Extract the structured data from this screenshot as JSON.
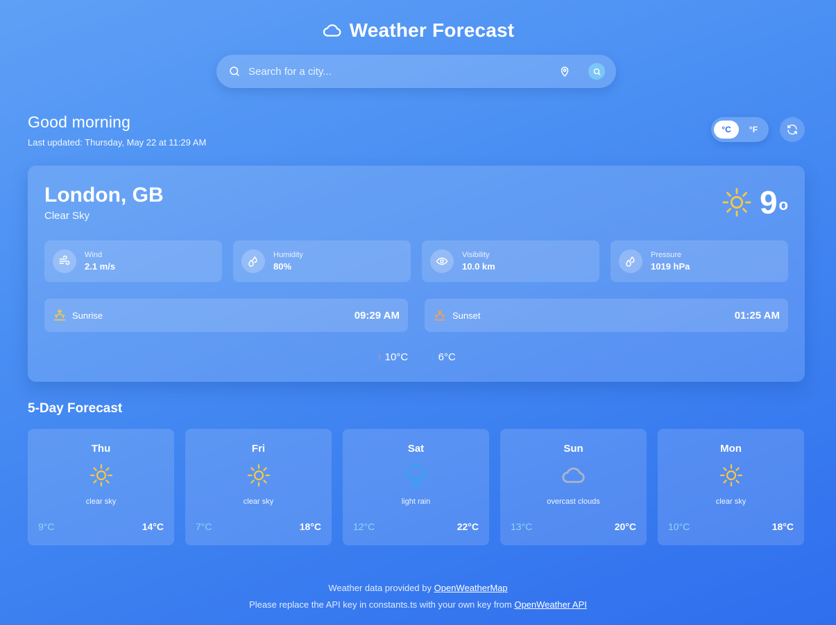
{
  "app": {
    "title": "Weather Forecast"
  },
  "search": {
    "placeholder": "Search for a city..."
  },
  "greeting": {
    "text": "Good morning",
    "updated": "Last updated: Thursday, May 22 at 11:29 AM"
  },
  "units": {
    "celsius": "°C",
    "fahrenheit": "°F",
    "selected": "°C"
  },
  "current": {
    "city": "London, GB",
    "condition": "Clear Sky",
    "temp": "9",
    "deg": "o",
    "stats": [
      {
        "label": "Wind",
        "value": "2.1 m/s",
        "icon": "wind-icon"
      },
      {
        "label": "Humidity",
        "value": "80%",
        "icon": "droplet-icon"
      },
      {
        "label": "Visibility",
        "value": "10.0 km",
        "icon": "eye-icon"
      },
      {
        "label": "Pressure",
        "value": "1019 hPa",
        "icon": "droplet-icon"
      }
    ],
    "sunrise": {
      "label": "Sunrise",
      "time": "09:29 AM"
    },
    "sunset": {
      "label": "Sunset",
      "time": "01:25 AM"
    },
    "high": "10°C",
    "low": "6°C"
  },
  "forecast": {
    "title": "5-Day Forecast",
    "days": [
      {
        "day": "Thu",
        "desc": "clear sky",
        "lo": "9°C",
        "hi": "14°C",
        "icon": "sun-icon"
      },
      {
        "day": "Fri",
        "desc": "clear sky",
        "lo": "7°C",
        "hi": "18°C",
        "icon": "sun-icon"
      },
      {
        "day": "Sat",
        "desc": "light rain",
        "lo": "12°C",
        "hi": "22°C",
        "icon": "rain-icon"
      },
      {
        "day": "Sun",
        "desc": "overcast clouds",
        "lo": "13°C",
        "hi": "20°C",
        "icon": "cloud-icon"
      },
      {
        "day": "Mon",
        "desc": "clear sky",
        "lo": "10°C",
        "hi": "18°C",
        "icon": "sun-icon"
      }
    ]
  },
  "footer": {
    "line1_prefix": "Weather data provided by ",
    "line1_link": "OpenWeatherMap",
    "line2_prefix": "Please replace the API key in constants.ts with your own key from ",
    "line2_link": "OpenWeather API"
  },
  "colors": {
    "sun": "#f5c842",
    "rain": "#3aa0f0",
    "cloud": "#a8b6c8",
    "high_arrow": "#f08a8a",
    "low_arrow": "#44b0f2",
    "low_temp": "#8fd5f7"
  }
}
